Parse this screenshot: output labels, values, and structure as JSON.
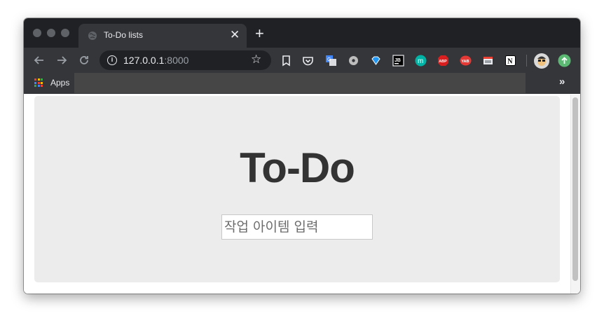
{
  "browser": {
    "tab": {
      "title": "To-Do lists"
    },
    "url": {
      "host": "127.0.0.1",
      "port": ":8000"
    },
    "bookmarks": {
      "apps_label": "Apps",
      "overflow": "»"
    },
    "extensions": [
      {
        "icon": "bookmark-icon"
      },
      {
        "icon": "pocket-icon",
        "color": "#e8eaed"
      },
      {
        "icon": "google-translate-icon",
        "color": "#4285f4"
      },
      {
        "icon": "settings-extension-icon",
        "color": "#bdbdbd"
      },
      {
        "icon": "diamond-icon",
        "color": "#2196f3"
      },
      {
        "icon": "jb-icon",
        "label": "JB"
      },
      {
        "icon": "mercury-icon",
        "label": "m",
        "color": "#00b3a4"
      },
      {
        "icon": "adblock-plus-icon",
        "label": "ABP",
        "color": "#d81e1e"
      },
      {
        "icon": "youtube-adblock-icon",
        "label": "YAB",
        "color": "#e53935"
      },
      {
        "icon": "window-icon",
        "color": "#e8eaed"
      },
      {
        "icon": "notion-icon",
        "label": "N"
      }
    ],
    "apps_colors": [
      "#ea4335",
      "#fbbc05",
      "#34a853",
      "#4285f4",
      "#ea4335",
      "#fbbc05",
      "#34a853",
      "#4285f4",
      "#ea4335"
    ]
  },
  "page": {
    "title": "To-Do",
    "input": {
      "placeholder": "작업 아이템 입력"
    }
  }
}
